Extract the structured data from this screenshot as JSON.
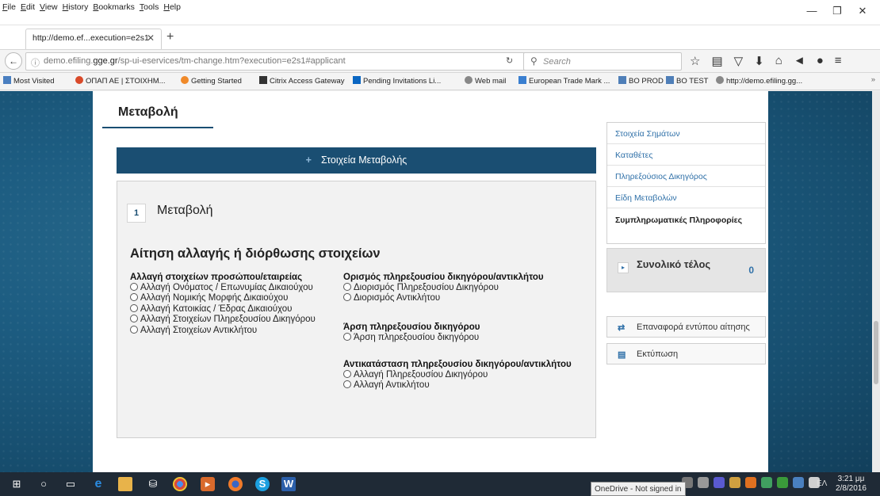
{
  "browser": {
    "menu": [
      "File",
      "Edit",
      "View",
      "History",
      "Bookmarks",
      "Tools",
      "Help"
    ],
    "tab_title": "http://demo.ef...execution=e2s1",
    "url_prefix": "demo.efiling.",
    "url_domain": "gge.gr",
    "url_suffix": "/sp-ui-eservices/tm-change.htm?execution=e2s1#applicant",
    "search_placeholder": "Search",
    "bookmarks": [
      "Most Visited",
      "ΟΠΑΠ ΑΕ | ΣΤΟΙΧΗΜ...",
      "Getting Started",
      "Citrix Access Gateway",
      "Pending Invitations Li...",
      "Web mail",
      "European Trade Mark ...",
      "BO PROD",
      "BO TEST",
      "http://demo.efiling.gg..."
    ]
  },
  "page": {
    "title": "Μεταβολή",
    "section_header": "Στοιχεία Μεταβολής",
    "step_number": "1",
    "step_title": "Μεταβολή",
    "form_title": "Αίτηση αλλαγής ή διόρθωσης στοιχείων",
    "groups": {
      "personal": {
        "title": "Αλλαγή στοιχείων προσώπου/εταιρείας",
        "options": [
          "Αλλαγή Ονόματος / Επωνυμίας Δικαιούχου",
          "Αλλαγή Νομικής Μορφής Δικαιούχου",
          "Αλλαγή Κατοικίας / Έδρας Δικαιούχου",
          "Αλλαγή Στοιχείων Πληρεξουσίου Δικηγόρου",
          "Αλλαγή Στοιχείων Αντικλήτου"
        ]
      },
      "appoint": {
        "title": "Ορισμός πληρεξουσίου δικηγόρου/αντικλήτου",
        "options": [
          "Διορισμός Πληρεξουσίου Δικηγόρου",
          "Διορισμός Αντικλήτου"
        ]
      },
      "revoke": {
        "title": "Άρση πληρεξουσίου δικηγόρου",
        "options": [
          "Άρση πληρεξουσίου δικηγόρου"
        ]
      },
      "replace": {
        "title": "Αντικατάσταση πληρεξουσίου δικηγόρου/αντικλήτου",
        "options": [
          "Αλλαγή Πληρεξουσίου Δικηγόρου",
          "Αλλαγή Αντικλήτου"
        ]
      }
    }
  },
  "sidebar": {
    "items": [
      "Στοιχεία Σημάτων",
      "Καταθέτες",
      "Πληρεξούσιος Δικηγόρος",
      "Είδη Μεταβολών",
      "Συμπληρωματικές Πληροφορίες"
    ],
    "total_label": "Συνολικό τέλος",
    "total_value": "0",
    "reset_label": "Επαναφορά εντύπου αίτησης",
    "print_label": "Εκτύπωση"
  },
  "taskbar": {
    "tooltip": "OneDrive - Not signed in",
    "language": "ΕΛ",
    "time": "3:21 μμ",
    "date": "2/8/2016"
  },
  "colors": {
    "primary": "#1a4e72",
    "link": "#2f70a8",
    "background": "#1d5d82"
  }
}
